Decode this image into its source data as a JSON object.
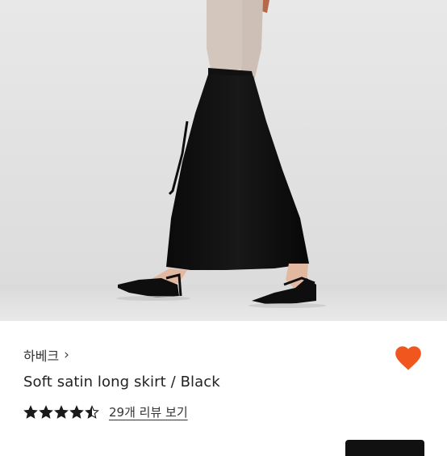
{
  "product": {
    "brand": "하베크",
    "brand_chevron": "›",
    "title": "Soft satin long skirt / Black",
    "rating_value": 4.5,
    "review_link_text": "29개 리뷰 보기"
  },
  "icons": {
    "heart": "heart-icon",
    "star": "star-icon",
    "chevron": "chevron-right-icon"
  },
  "colors": {
    "heart": "#F0561E",
    "stars": "#1a1a1a",
    "skirt": "#0d0d0d",
    "background": "#e6e6e6"
  }
}
